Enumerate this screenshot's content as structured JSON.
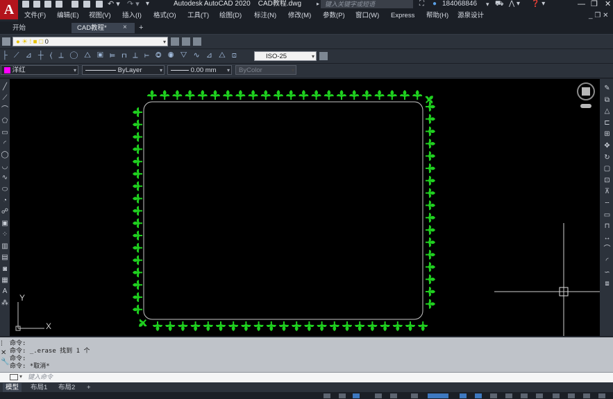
{
  "app": {
    "title": "Autodesk AutoCAD 2020",
    "document": "CAD教程.dwg",
    "search_placeholder": "键入关键字或短语",
    "user_id": "184068846",
    "logo_text": "A"
  },
  "menu": [
    "文件(F)",
    "编辑(E)",
    "视图(V)",
    "插入(I)",
    "格式(O)",
    "工具(T)",
    "绘图(D)",
    "标注(N)",
    "修改(M)",
    "参数(P)",
    "窗口(W)",
    "Express",
    "帮助(H)",
    "源泉设计"
  ],
  "tabs": {
    "start": "开始",
    "doc": "CAD教程*",
    "close": "×",
    "add": "+"
  },
  "toolbars": {
    "layer_combo": "0",
    "dim_style": "ISO-25",
    "color": "洋红",
    "color_swatch": "#ff00ff",
    "linetype": "ByLayer",
    "lineweight": "0.00 mm",
    "plotstyle": "ByColor"
  },
  "canvas": {
    "leaf_color": "#1fd01f",
    "frame_color": "#bfbfbfm",
    "ucs_x": "X",
    "ucs_y": "Y"
  },
  "command": {
    "history": [
      "命令:",
      "命令: _.erase 找到 1 个",
      "命令:",
      "命令: *取消*"
    ],
    "input_placeholder": "键入命令"
  },
  "layouts": [
    "模型",
    "布局1",
    "布局2",
    "+"
  ],
  "window_buttons": {
    "minimize": "—",
    "restore": "❐",
    "close": "✕"
  }
}
